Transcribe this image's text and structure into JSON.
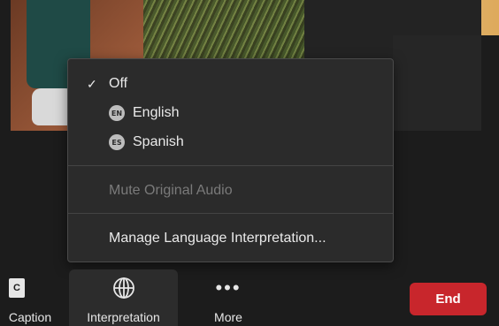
{
  "menu": {
    "off_label": "Off",
    "english": {
      "badge": "EN",
      "label": "English"
    },
    "spanish": {
      "badge": "ES",
      "label": "Spanish"
    },
    "mute_original_label": "Mute Original Audio",
    "manage_label": "Manage Language Interpretation..."
  },
  "toolbar": {
    "caption_label": "Caption",
    "caption_icon_text": "C",
    "interpretation_label": "Interpretation",
    "more_label": "More",
    "more_icon_text": "•••",
    "end_label": "End"
  },
  "icons": {
    "check": "✓",
    "globe": "globe-icon",
    "more": "more-dots-icon",
    "caption": "cc-icon"
  },
  "colors": {
    "end_button": "#c8262c",
    "menu_bg": "#2b2b2b",
    "background": "#1c1c1c"
  }
}
